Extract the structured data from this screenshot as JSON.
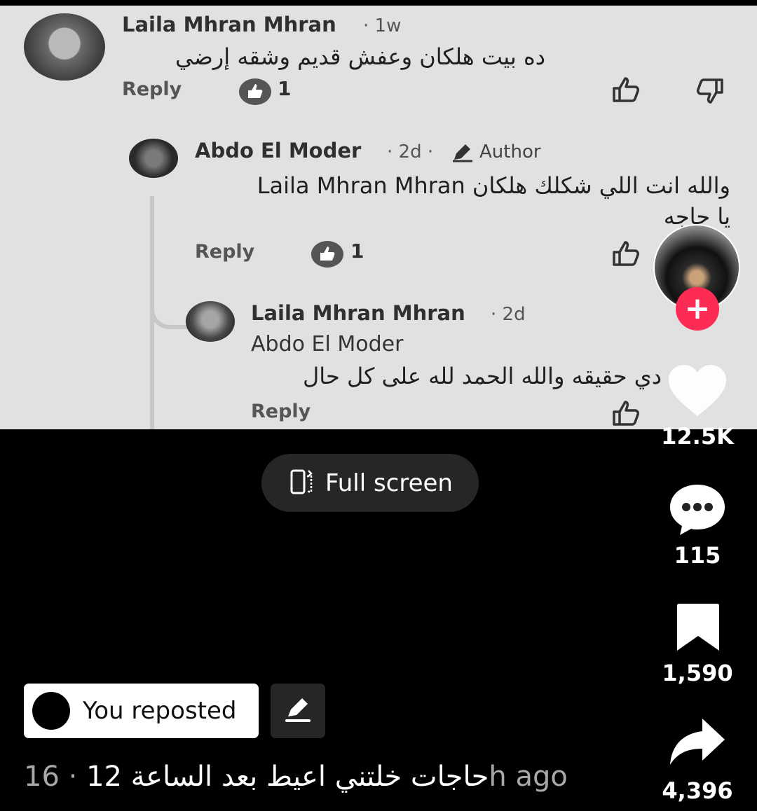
{
  "comments": {
    "c1": {
      "name": "Laila Mhran Mhran",
      "meta": "· 1w",
      "text": "ده بيت هلكان وعفش قديم وشقه إرضي",
      "reply": "Reply",
      "likes": "1"
    },
    "c2": {
      "name": "Abdo El Moder",
      "meta": "· 2d ·",
      "badge": "Author",
      "text": "والله انت اللي شكلك هلكان Laila Mhran Mhran",
      "text2": "يا حاجه",
      "reply": "Reply",
      "likes": "1"
    },
    "c3": {
      "name": "Laila Mhran Mhran",
      "meta": "· 2d",
      "mention": "Abdo El Moder",
      "text": "دي حقيقه والله الحمد لله على كل حال",
      "reply": "Reply"
    }
  },
  "actions": {
    "likes": "12.5K",
    "comments": "115",
    "saves": "1,590",
    "shares": "4,396",
    "follow_symbol": "+"
  },
  "fullscreen_label": "Full screen",
  "repost_label": "You reposted",
  "caption": {
    "text": "حاجات خلتني اعيط بعد الساعة 12",
    "time": "· 16h ago"
  },
  "icons": [
    "profile-avatar",
    "follow-plus-icon",
    "heart-icon",
    "comment-icon",
    "bookmark-icon",
    "share-icon",
    "fullscreen-icon",
    "edit-icon",
    "thumbs-up-icon",
    "thumbs-down-icon"
  ],
  "colors": {
    "follow": "#fe2c55",
    "background": "#000000",
    "video_bg": "#e1e1e1",
    "pill": "#262626"
  }
}
